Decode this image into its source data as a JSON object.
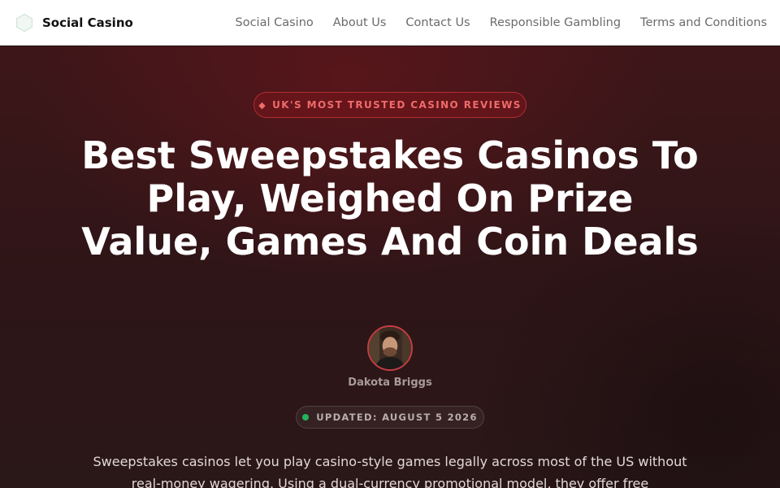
{
  "nav": {
    "brand": "Social Casino",
    "links": [
      "Social Casino",
      "About Us",
      "Contact Us",
      "Responsible Gambling",
      "Terms and Conditions"
    ]
  },
  "hero": {
    "badge": "UK'S MOST TRUSTED CASINO REVIEWS",
    "badge_icon": "shield-icon",
    "title": "Best Sweepstakes Casinos To Play, Weighed On Prize Value, Games And Coin Deals",
    "author": "Dakota Briggs",
    "updated": "UPDATED: AUGUST 5 2026",
    "intro": "Sweepstakes casinos let you play casino-style games legally across most of the US without real-money wagering. Using a dual-currency promotional model, they offer free"
  },
  "colors": {
    "accent": "#ef6b6b",
    "status": "#22b35a",
    "nav_background": "#ffffff",
    "hero_background": "#2e1517"
  }
}
